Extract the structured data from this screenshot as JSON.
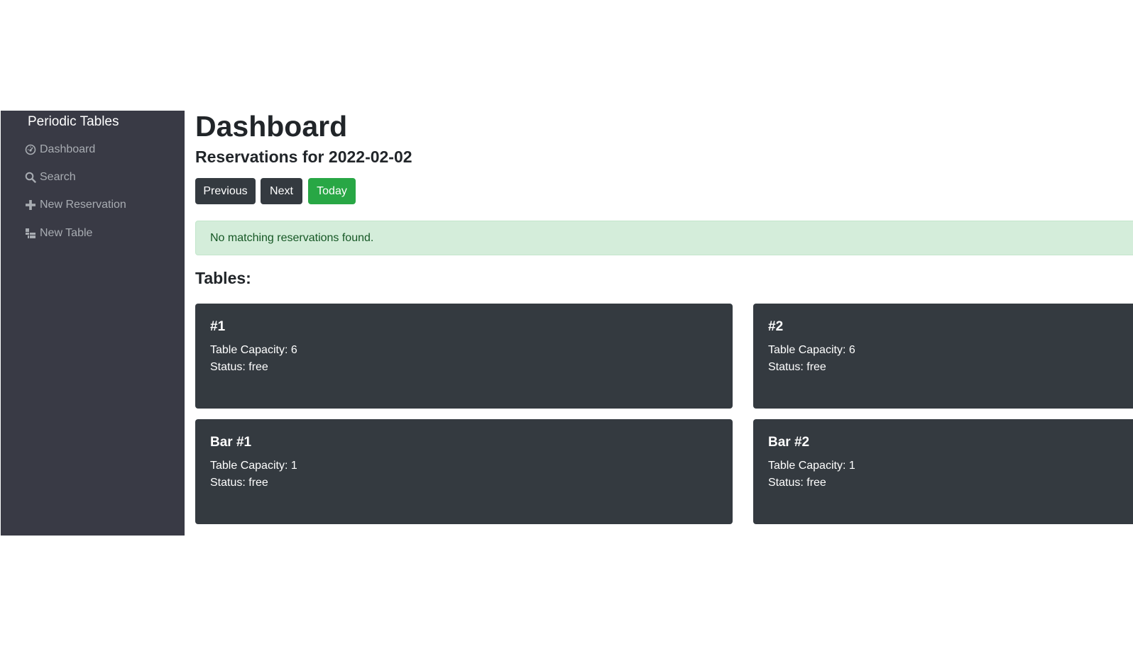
{
  "sidebar": {
    "brand": "Periodic Tables",
    "items": [
      {
        "label": "Dashboard",
        "icon": "dashboard-icon"
      },
      {
        "label": "Search",
        "icon": "search-icon"
      },
      {
        "label": "New Reservation",
        "icon": "plus-icon"
      },
      {
        "label": "New Table",
        "icon": "table-icon"
      }
    ]
  },
  "main": {
    "title": "Dashboard",
    "subtitle": "Reservations for 2022-02-02",
    "buttons": {
      "previous": "Previous",
      "next": "Next",
      "today": "Today"
    },
    "alert": "No matching reservations found.",
    "tables_heading": "Tables:",
    "tables": [
      {
        "name": "#1",
        "capacity": "Table Capacity: 6",
        "status": "Status: free"
      },
      {
        "name": "#2",
        "capacity": "Table Capacity: 6",
        "status": "Status: free"
      },
      {
        "name": "Bar #1",
        "capacity": "Table Capacity: 1",
        "status": "Status: free"
      },
      {
        "name": "Bar #2",
        "capacity": "Table Capacity: 1",
        "status": "Status: free"
      }
    ]
  },
  "colors": {
    "sidebar_bg": "#393a45",
    "card_bg": "#343a40",
    "today_button": "#28a745",
    "alert_bg": "#d4edda",
    "alert_text": "#155724"
  }
}
